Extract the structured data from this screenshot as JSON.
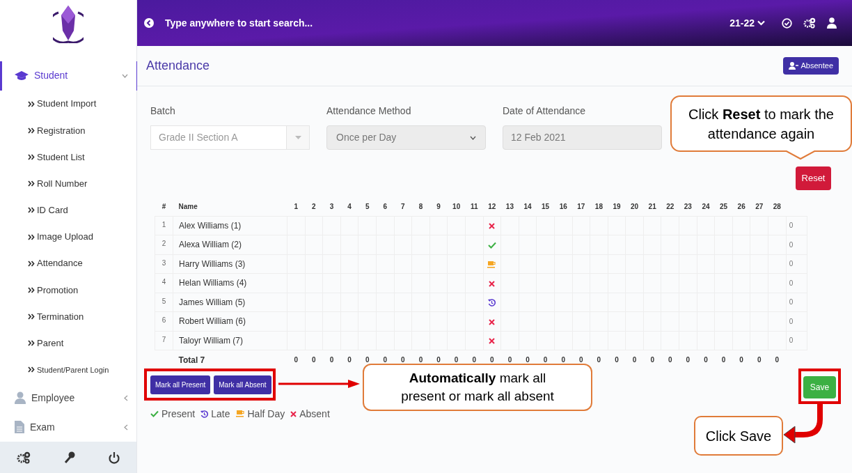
{
  "sidebar": {
    "groups": [
      {
        "label": "Student",
        "expanded": true,
        "selected": true,
        "items": [
          "Student Import",
          "Registration",
          "Student List",
          "Roll Number",
          "ID Card",
          "Image Upload",
          "Attendance",
          "Promotion",
          "Termination",
          "Parent",
          "Student/Parent Login"
        ]
      },
      {
        "label": "Employee",
        "expanded": false,
        "selected": false
      },
      {
        "label": "Exam",
        "expanded": false,
        "selected": false
      }
    ]
  },
  "topbar": {
    "search_placeholder": "Type anywhere to start search...",
    "session": "21-22"
  },
  "page": {
    "title": "Attendance",
    "absentee_button": "Absentee"
  },
  "form": {
    "fields": [
      {
        "label": "Batch",
        "value": "Grade II Section A",
        "kind": "combo"
      },
      {
        "label": "Attendance Method",
        "value": "Once per Day",
        "kind": "select"
      },
      {
        "label": "Date of Attendance",
        "value": "12 Feb 2021",
        "kind": "text"
      }
    ]
  },
  "reset_button": "Reset",
  "table": {
    "columns": [
      "#",
      "Name",
      "1",
      "2",
      "3",
      "4",
      "5",
      "6",
      "7",
      "8",
      "9",
      "10",
      "11",
      "12",
      "13",
      "14",
      "15",
      "16",
      "17",
      "18",
      "19",
      "20",
      "21",
      "22",
      "23",
      "24",
      "25",
      "26",
      "27",
      "28"
    ],
    "rows": [
      {
        "num": "1",
        "name": "Alex Williams (1)",
        "marks": [
          {
            "kind": "blank"
          },
          {
            "kind": "blank"
          },
          {
            "kind": "blank"
          },
          {
            "kind": "blank"
          },
          {
            "kind": "blank"
          },
          {
            "kind": "blank"
          },
          {
            "kind": "blank"
          },
          {
            "kind": "blank"
          },
          {
            "kind": "blank"
          },
          {
            "kind": "blank"
          },
          {
            "kind": "blank"
          },
          {
            "kind": "absent"
          },
          {
            "kind": "blank"
          },
          {
            "kind": "blank"
          },
          {
            "kind": "blank"
          },
          {
            "kind": "blank"
          },
          {
            "kind": "blank"
          },
          {
            "kind": "blank"
          },
          {
            "kind": "blank"
          },
          {
            "kind": "blank"
          },
          {
            "kind": "blank"
          },
          {
            "kind": "blank"
          },
          {
            "kind": "blank"
          },
          {
            "kind": "blank"
          },
          {
            "kind": "blank"
          },
          {
            "kind": "blank"
          },
          {
            "kind": "blank"
          },
          {
            "kind": "blank"
          }
        ],
        "total": "0"
      },
      {
        "num": "2",
        "name": "Alexa William (2)",
        "marks": [
          {
            "kind": "blank"
          },
          {
            "kind": "blank"
          },
          {
            "kind": "blank"
          },
          {
            "kind": "blank"
          },
          {
            "kind": "blank"
          },
          {
            "kind": "blank"
          },
          {
            "kind": "blank"
          },
          {
            "kind": "blank"
          },
          {
            "kind": "blank"
          },
          {
            "kind": "blank"
          },
          {
            "kind": "blank"
          },
          {
            "kind": "present"
          },
          {
            "kind": "blank"
          },
          {
            "kind": "blank"
          },
          {
            "kind": "blank"
          },
          {
            "kind": "blank"
          },
          {
            "kind": "blank"
          },
          {
            "kind": "blank"
          },
          {
            "kind": "blank"
          },
          {
            "kind": "blank"
          },
          {
            "kind": "blank"
          },
          {
            "kind": "blank"
          },
          {
            "kind": "blank"
          },
          {
            "kind": "blank"
          },
          {
            "kind": "blank"
          },
          {
            "kind": "blank"
          },
          {
            "kind": "blank"
          },
          {
            "kind": "blank"
          }
        ],
        "total": "0"
      },
      {
        "num": "3",
        "name": "Harry Williams (3)",
        "marks": [
          {
            "kind": "blank"
          },
          {
            "kind": "blank"
          },
          {
            "kind": "blank"
          },
          {
            "kind": "blank"
          },
          {
            "kind": "blank"
          },
          {
            "kind": "blank"
          },
          {
            "kind": "blank"
          },
          {
            "kind": "blank"
          },
          {
            "kind": "blank"
          },
          {
            "kind": "blank"
          },
          {
            "kind": "blank"
          },
          {
            "kind": "halfday"
          },
          {
            "kind": "blank"
          },
          {
            "kind": "blank"
          },
          {
            "kind": "blank"
          },
          {
            "kind": "blank"
          },
          {
            "kind": "blank"
          },
          {
            "kind": "blank"
          },
          {
            "kind": "blank"
          },
          {
            "kind": "blank"
          },
          {
            "kind": "blank"
          },
          {
            "kind": "blank"
          },
          {
            "kind": "blank"
          },
          {
            "kind": "blank"
          },
          {
            "kind": "blank"
          },
          {
            "kind": "blank"
          },
          {
            "kind": "blank"
          },
          {
            "kind": "blank"
          }
        ],
        "total": "0"
      },
      {
        "num": "4",
        "name": "Helan Williams (4)",
        "marks": [
          {
            "kind": "blank"
          },
          {
            "kind": "blank"
          },
          {
            "kind": "blank"
          },
          {
            "kind": "blank"
          },
          {
            "kind": "blank"
          },
          {
            "kind": "blank"
          },
          {
            "kind": "blank"
          },
          {
            "kind": "blank"
          },
          {
            "kind": "blank"
          },
          {
            "kind": "blank"
          },
          {
            "kind": "blank"
          },
          {
            "kind": "absent"
          },
          {
            "kind": "blank"
          },
          {
            "kind": "blank"
          },
          {
            "kind": "blank"
          },
          {
            "kind": "blank"
          },
          {
            "kind": "blank"
          },
          {
            "kind": "blank"
          },
          {
            "kind": "blank"
          },
          {
            "kind": "blank"
          },
          {
            "kind": "blank"
          },
          {
            "kind": "blank"
          },
          {
            "kind": "blank"
          },
          {
            "kind": "blank"
          },
          {
            "kind": "blank"
          },
          {
            "kind": "blank"
          },
          {
            "kind": "blank"
          },
          {
            "kind": "blank"
          }
        ],
        "total": "0"
      },
      {
        "num": "5",
        "name": "James William (5)",
        "marks": [
          {
            "kind": "blank"
          },
          {
            "kind": "blank"
          },
          {
            "kind": "blank"
          },
          {
            "kind": "blank"
          },
          {
            "kind": "blank"
          },
          {
            "kind": "blank"
          },
          {
            "kind": "blank"
          },
          {
            "kind": "blank"
          },
          {
            "kind": "blank"
          },
          {
            "kind": "blank"
          },
          {
            "kind": "blank"
          },
          {
            "kind": "late"
          },
          {
            "kind": "blank"
          },
          {
            "kind": "blank"
          },
          {
            "kind": "blank"
          },
          {
            "kind": "blank"
          },
          {
            "kind": "blank"
          },
          {
            "kind": "blank"
          },
          {
            "kind": "blank"
          },
          {
            "kind": "blank"
          },
          {
            "kind": "blank"
          },
          {
            "kind": "blank"
          },
          {
            "kind": "blank"
          },
          {
            "kind": "blank"
          },
          {
            "kind": "blank"
          },
          {
            "kind": "blank"
          },
          {
            "kind": "blank"
          },
          {
            "kind": "blank"
          }
        ],
        "total": "0"
      },
      {
        "num": "6",
        "name": "Robert William (6)",
        "marks": [
          {
            "kind": "blank"
          },
          {
            "kind": "blank"
          },
          {
            "kind": "blank"
          },
          {
            "kind": "blank"
          },
          {
            "kind": "blank"
          },
          {
            "kind": "blank"
          },
          {
            "kind": "blank"
          },
          {
            "kind": "blank"
          },
          {
            "kind": "blank"
          },
          {
            "kind": "blank"
          },
          {
            "kind": "blank"
          },
          {
            "kind": "absent"
          },
          {
            "kind": "blank"
          },
          {
            "kind": "blank"
          },
          {
            "kind": "blank"
          },
          {
            "kind": "blank"
          },
          {
            "kind": "blank"
          },
          {
            "kind": "blank"
          },
          {
            "kind": "blank"
          },
          {
            "kind": "blank"
          },
          {
            "kind": "blank"
          },
          {
            "kind": "blank"
          },
          {
            "kind": "blank"
          },
          {
            "kind": "blank"
          },
          {
            "kind": "blank"
          },
          {
            "kind": "blank"
          },
          {
            "kind": "blank"
          },
          {
            "kind": "blank"
          }
        ],
        "total": "0"
      },
      {
        "num": "7",
        "name": "Taloyr William (7)",
        "marks": [
          {
            "kind": "blank"
          },
          {
            "kind": "blank"
          },
          {
            "kind": "blank"
          },
          {
            "kind": "blank"
          },
          {
            "kind": "blank"
          },
          {
            "kind": "blank"
          },
          {
            "kind": "blank"
          },
          {
            "kind": "blank"
          },
          {
            "kind": "blank"
          },
          {
            "kind": "blank"
          },
          {
            "kind": "blank"
          },
          {
            "kind": "absent"
          },
          {
            "kind": "blank"
          },
          {
            "kind": "blank"
          },
          {
            "kind": "blank"
          },
          {
            "kind": "blank"
          },
          {
            "kind": "blank"
          },
          {
            "kind": "blank"
          },
          {
            "kind": "blank"
          },
          {
            "kind": "blank"
          },
          {
            "kind": "blank"
          },
          {
            "kind": "blank"
          },
          {
            "kind": "blank"
          },
          {
            "kind": "blank"
          },
          {
            "kind": "blank"
          },
          {
            "kind": "blank"
          },
          {
            "kind": "blank"
          },
          {
            "kind": "blank"
          }
        ],
        "total": "0"
      }
    ],
    "total_label": "Total 7",
    "totals": [
      "0",
      "0",
      "0",
      "0",
      "0",
      "0",
      "0",
      "0",
      "0",
      "0",
      "0",
      "0",
      "0",
      "0",
      "0",
      "0",
      "0",
      "0",
      "0",
      "0",
      "0",
      "0",
      "0",
      "0",
      "0",
      "0",
      "0",
      "0"
    ]
  },
  "buttons": [
    "Mark all Present",
    "Mark all Absent"
  ],
  "save_button": "Save",
  "legend": [
    {
      "kind": "present",
      "label": "Present"
    },
    {
      "kind": "late",
      "label": "Late"
    },
    {
      "kind": "halfday",
      "label": "Half Day"
    },
    {
      "kind": "absent",
      "label": "Absent"
    }
  ],
  "annotations": {
    "reset_note": "Click **Reset** to mark the attendance again",
    "mark_note": "**Automatically** mark all present or mark all absent",
    "save_note": "Click Save"
  }
}
